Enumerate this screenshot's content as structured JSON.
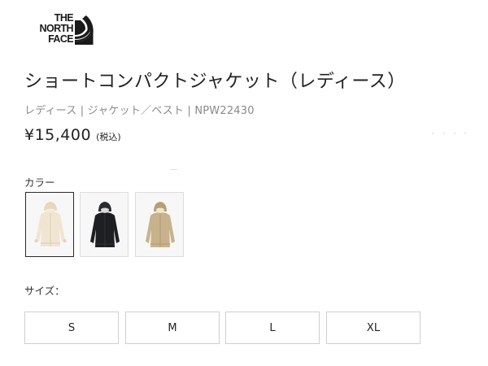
{
  "brand": {
    "logo_lines": [
      "THE",
      "NORTH",
      "FACE"
    ]
  },
  "product": {
    "title": "ショートコンパクトジャケット（レディース）",
    "breadcrumb": "レディース | ジャケット／ベスト | NPW22430",
    "price": "¥15,400",
    "tax_note": "(税込)"
  },
  "color_section": {
    "label": "カラー",
    "swatches": [
      {
        "icon": "jacket-ivory",
        "color": "#efe5d2",
        "selected": true
      },
      {
        "icon": "jacket-black",
        "color": "#1e1f22",
        "selected": false
      },
      {
        "icon": "jacket-khaki",
        "color": "#c8b28c",
        "selected": false
      }
    ]
  },
  "size_section": {
    "label": "サイズ：",
    "options": [
      "S",
      "M",
      "L",
      "XL"
    ]
  },
  "colors": {
    "text": "#222222",
    "muted": "#8a8a8a",
    "border": "#cfcfcf",
    "selected_border": "#2a2a2a"
  }
}
